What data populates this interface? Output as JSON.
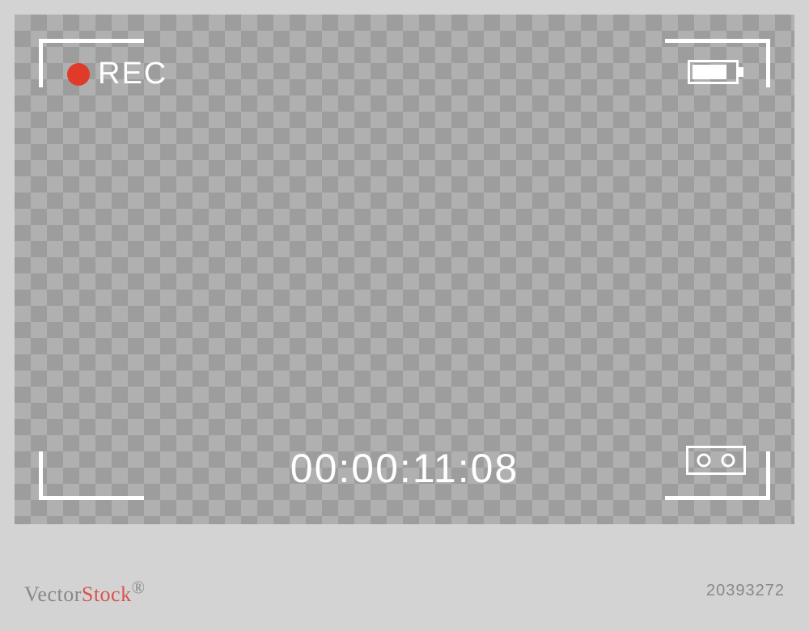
{
  "recording": {
    "label": "REC",
    "dot_color": "#e03a2a"
  },
  "timecode": "00:00:11:08",
  "battery": {
    "level_percent": 80
  },
  "watermark": {
    "brand_prefix": "Vector",
    "brand_suffix": "Stock",
    "superscript": "®",
    "id": "20393272"
  },
  "colors": {
    "overlay_text": "#ffffff",
    "rec_dot": "#e03a2a",
    "background_light": "#d3d3d3",
    "checker_dark": "#9d9d9d",
    "checker_light": "#b0b0b0"
  }
}
